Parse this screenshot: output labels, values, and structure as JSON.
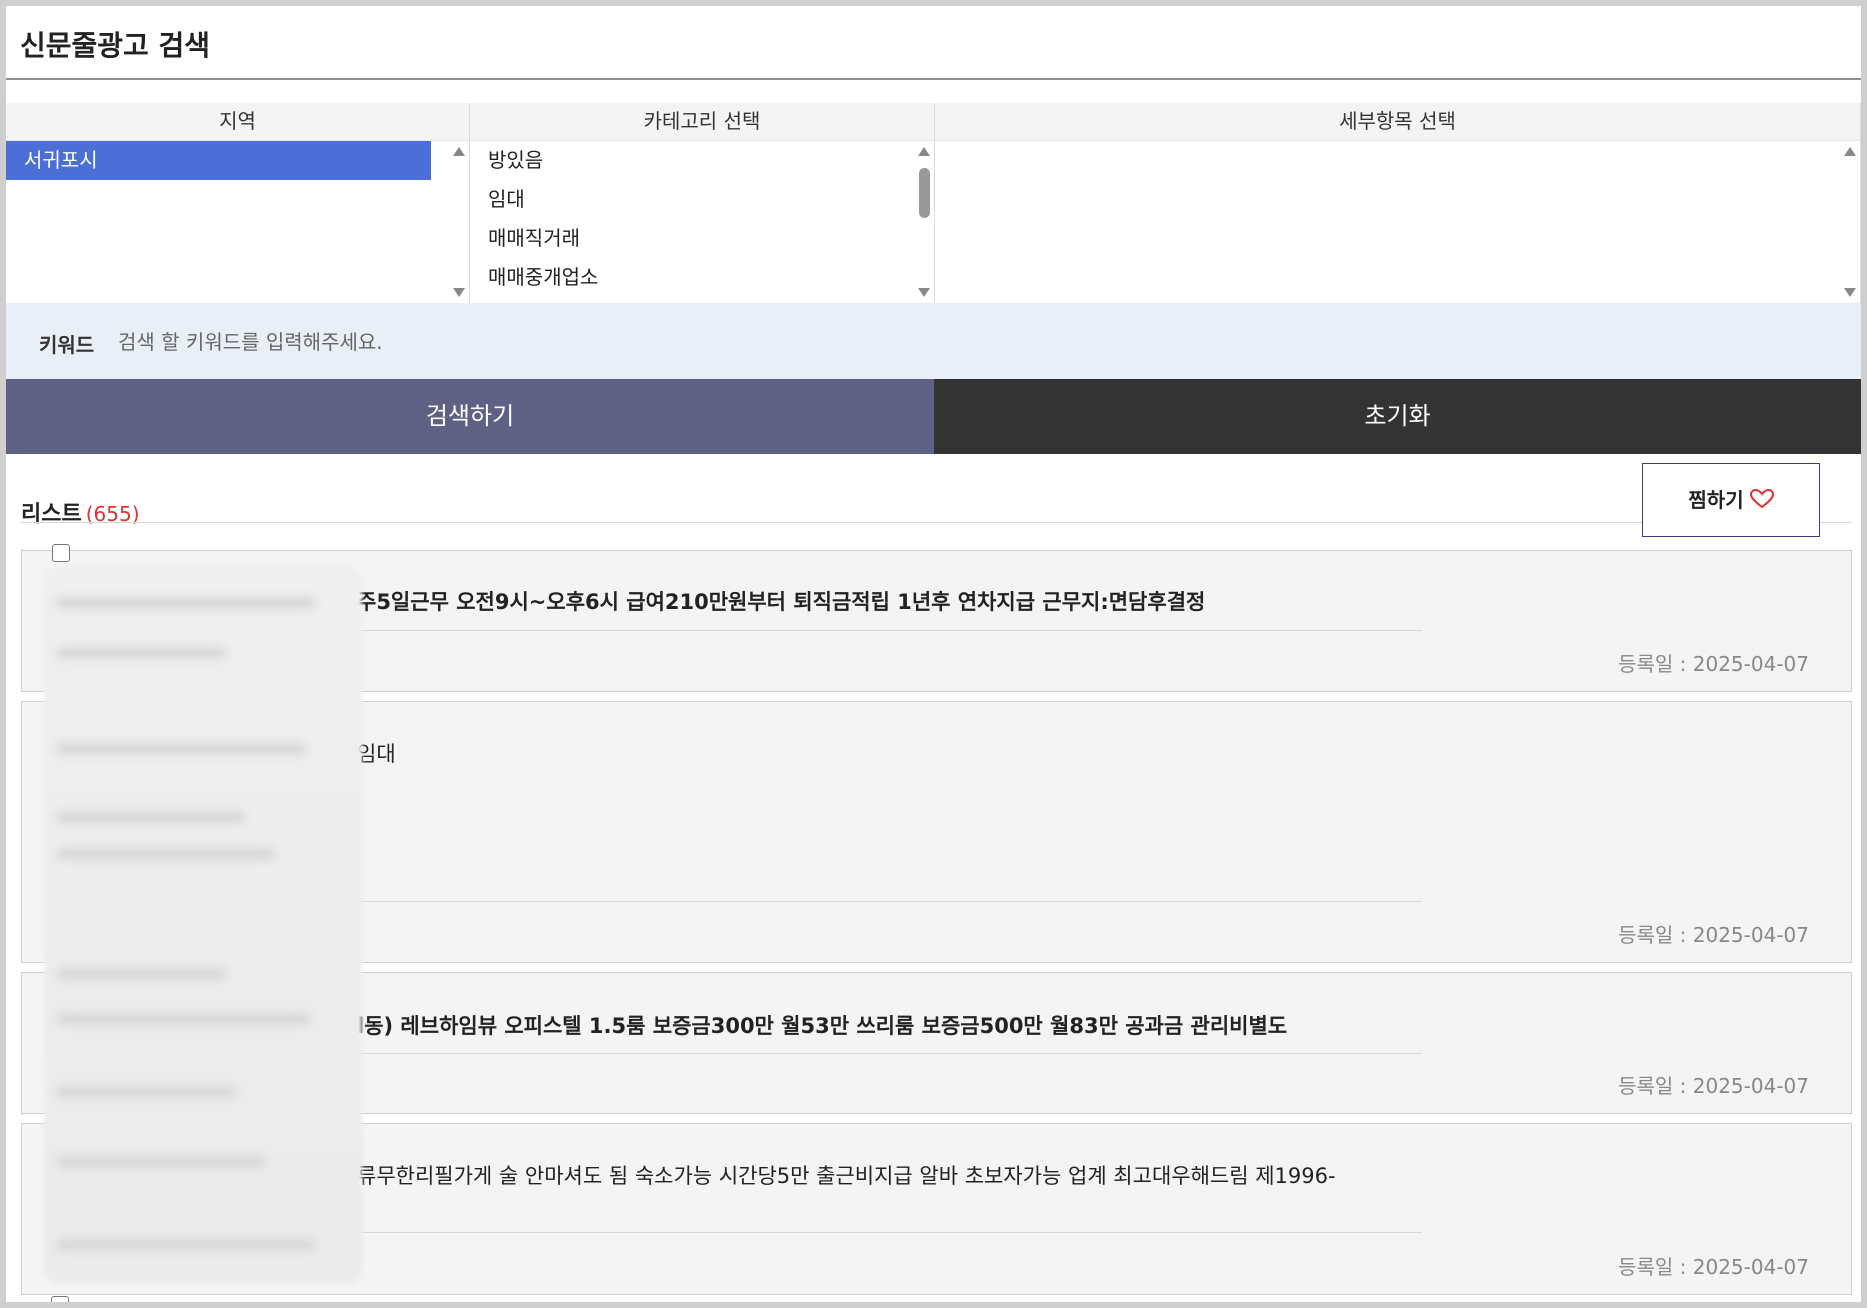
{
  "page": {
    "title": "신문줄광고 검색"
  },
  "filters": {
    "region": {
      "header": "지역",
      "items": [
        "서귀포시"
      ],
      "selected_index": 0
    },
    "category": {
      "header": "카테고리 선택",
      "items": [
        "방있음",
        "임대",
        "매매직거래",
        "매매중개업소"
      ]
    },
    "detail": {
      "header": "세부항목 선택",
      "items": []
    }
  },
  "keyword": {
    "label": "키워드",
    "placeholder": "검색 할 키워드를 입력해주세요."
  },
  "buttons": {
    "search": "검색하기",
    "reset": "초기화"
  },
  "list": {
    "title": "리스트",
    "count": "(655)",
    "favorite_label": "찜하기",
    "items": [
      {
        "title": "주5일근무 오전9시~오후6시 급여210만원부터 퇴직금적립 1년후 연차지급 근무지:면담후결정",
        "date": "등록일 : 2025-04-07"
      },
      {
        "title": "임대",
        "date": "등록일 : 2025-04-07"
      },
      {
        "title": "l동) 레브하임뷰 오피스텔 1.5룸 보증금300만 월53만 쓰리룸 보증금500만 월83만 공과금 관리비별도",
        "date": "등록일 : 2025-04-07"
      },
      {
        "title": "류무한리필가게 술 안마셔도 됨 숙소가능 시간당5만 출근비지급 알바 초보자가능 업계 최고대우해드림 제1996-",
        "date": "등록일 : 2025-04-07"
      }
    ]
  },
  "colors": {
    "selected": "#4b6fd6",
    "search_button": "#5e6183",
    "reset_button": "#333333",
    "count": "#dd3333"
  },
  "icons": {
    "favorite": "heart-icon",
    "scroll_up": "arrow-up-icon",
    "scroll_down": "arrow-down-icon"
  }
}
